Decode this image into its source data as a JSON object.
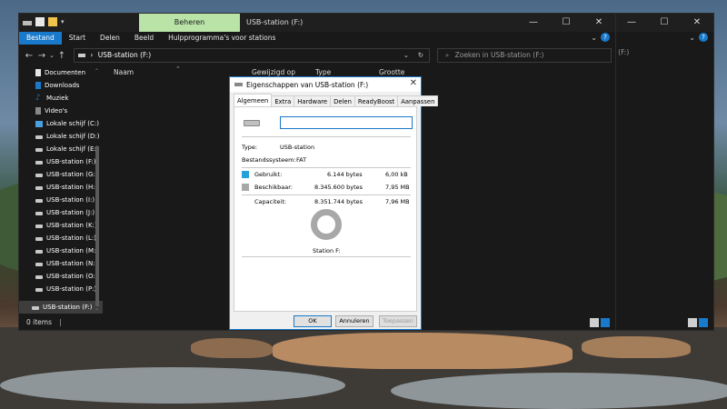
{
  "background": {
    "sky": "#6f8aa5",
    "rock": "#b98b62"
  },
  "back_window": {
    "search_placeholder_tail": "n (F:)"
  },
  "front_window": {
    "context_tab": "Beheren",
    "title": "USB-station (F:)",
    "caption_buttons": [
      "—",
      "☐",
      "✕"
    ],
    "ribbon_tabs": [
      "Bestand",
      "Start",
      "Delen",
      "Beeld",
      "Hulpprogramma's voor stations"
    ],
    "address": "USB-station (F:)",
    "search_placeholder": "Zoeken in USB-station (F:)",
    "columns": [
      "Naam",
      "Gewijzigd op",
      "Type",
      "Grootte"
    ],
    "sidebar": [
      {
        "label": "Documenten",
        "icon": "document-icon"
      },
      {
        "label": "Downloads",
        "icon": "download-icon"
      },
      {
        "label": "Muziek",
        "icon": "music-icon"
      },
      {
        "label": "Video's",
        "icon": "video-icon"
      },
      {
        "label": "Lokale schijf (C:)",
        "icon": "drive-icon"
      },
      {
        "label": "Lokale schijf (D:)",
        "icon": "drive-icon"
      },
      {
        "label": "Lokale schijf (E:)",
        "icon": "drive-icon"
      },
      {
        "label": "USB-station (F:)",
        "icon": "usb-drive-icon"
      },
      {
        "label": "USB-station (G:)",
        "icon": "usb-drive-icon"
      },
      {
        "label": "USB-station (H:)",
        "icon": "usb-drive-icon"
      },
      {
        "label": "USB-station (I:)",
        "icon": "usb-drive-icon"
      },
      {
        "label": "USB-station (J:)",
        "icon": "usb-drive-icon"
      },
      {
        "label": "USB-station (K:)",
        "icon": "usb-drive-icon"
      },
      {
        "label": "USB-station (L:)",
        "icon": "usb-drive-icon"
      },
      {
        "label": "USB-station (M:)",
        "icon": "usb-drive-icon"
      },
      {
        "label": "USB-station (N:)",
        "icon": "usb-drive-icon"
      },
      {
        "label": "USB-station (O:)",
        "icon": "usb-drive-icon"
      },
      {
        "label": "USB-station (P:)",
        "icon": "usb-drive-icon"
      }
    ],
    "selected_item": "USB-station (F:)",
    "status": "0 items",
    "accent": "#1979ca"
  },
  "dialog": {
    "title": "Eigenschappen van USB-station (F:)",
    "tabs": [
      "Algemeen",
      "Extra",
      "Hardware",
      "Delen",
      "ReadyBoost",
      "Aanpassen"
    ],
    "active_tab": "Algemeen",
    "name_value": "",
    "type_label": "Type:",
    "type_value": "USB-station",
    "fs_label": "Bestandssysteem:",
    "fs_value": "FAT",
    "used_label": "Gebruikt:",
    "used_bytes": "6.144 bytes",
    "used_size": "6,00 kB",
    "free_label": "Beschikbaar:",
    "free_bytes": "8.345.600 bytes",
    "free_size": "7,95 MB",
    "capacity_label": "Capaciteit:",
    "capacity_bytes": "8.351.744 bytes",
    "capacity_size": "7,96 MB",
    "drive_label": "Station F:",
    "used_color": "#26a0da",
    "free_color": "#a8a8a8",
    "ok": "OK",
    "cancel": "Annuleren",
    "apply": "Toepassen"
  }
}
